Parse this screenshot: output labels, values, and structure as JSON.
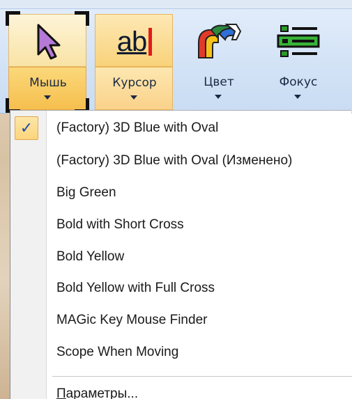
{
  "ribbon": {
    "buttons": [
      {
        "label": "Мышь",
        "icon": "mouse-pointer-icon",
        "state": "pressed"
      },
      {
        "label": "Курсор",
        "icon": "text-cursor-icon",
        "icon_text": "ab",
        "state": "hover"
      },
      {
        "label": "Цвет",
        "icon": "color-ribbon-icon",
        "state": "normal"
      },
      {
        "label": "Фокус",
        "icon": "focus-list-icon",
        "state": "normal"
      }
    ]
  },
  "menu": {
    "items": [
      {
        "label": "(Factory) 3D Blue with Oval",
        "checked": true
      },
      {
        "label": "(Factory) 3D Blue with Oval (Изменено)",
        "checked": false
      },
      {
        "label": "Big Green",
        "checked": false
      },
      {
        "label": "Bold with Short Cross",
        "checked": false
      },
      {
        "label": "Bold Yellow",
        "checked": false
      },
      {
        "label": "Bold Yellow with Full Cross",
        "checked": false
      },
      {
        "label": "MAGic Key Mouse Finder",
        "checked": false
      },
      {
        "label": "Scope When Moving",
        "checked": false
      }
    ],
    "options_mnemonic": "П",
    "options_rest": "араметры...",
    "check_glyph": "✓"
  },
  "colors": {
    "accent_pressed": "#f6bf4e",
    "accent_hover": "#f9d27a",
    "check": "#1f4aa8",
    "pointer_fill": "#b57ad8"
  }
}
